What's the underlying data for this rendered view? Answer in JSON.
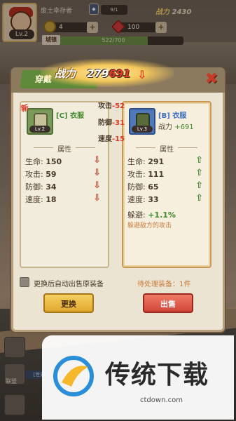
{
  "hud": {
    "player_name": "废土幸存者",
    "level": "Lv.2",
    "vip": "9/1",
    "power_label": "战力",
    "power_value": "2430",
    "coins": "4",
    "gems": "100",
    "xp_text": "522/700",
    "xp_progress": 0.746,
    "levelup_label": "城镇"
  },
  "dialog": {
    "tab_label": "穿戴",
    "power_label": "战力",
    "power_value_prefix": "279",
    "power_value_red": "691",
    "close_icon": "close-icon",
    "floating_diffs": [
      {
        "label": "攻击",
        "value": "-52"
      },
      {
        "label": "防御",
        "value": "-31"
      },
      {
        "label": "速度",
        "value": "-15"
      }
    ],
    "current": {
      "new_tag": "新",
      "name": "[C] 衣服",
      "level": "Lv.2",
      "section": "属性",
      "stats": [
        {
          "label": "生命:",
          "value": "150",
          "trend": "down"
        },
        {
          "label": "攻击:",
          "value": "59",
          "trend": "down"
        },
        {
          "label": "防御:",
          "value": "34",
          "trend": "down"
        },
        {
          "label": "速度:",
          "value": "18",
          "trend": "down"
        }
      ]
    },
    "candidate": {
      "name": "[B] 衣服",
      "level": "Lv.3",
      "power_label": "战力",
      "power_diff": "+691",
      "section": "属性",
      "stats": [
        {
          "label": "生命:",
          "value": "291",
          "trend": "up"
        },
        {
          "label": "攻击:",
          "value": "111",
          "trend": "up"
        },
        {
          "label": "防御:",
          "value": "65",
          "trend": "up"
        },
        {
          "label": "速度:",
          "value": "33",
          "trend": "up"
        }
      ],
      "dodge_label": "躲避:",
      "dodge_value": "+1.1%",
      "dodge_desc": "躲避敌方的攻击"
    },
    "auto_sell_label": "更换后自动出售原装备",
    "pending_label": "待处理装备：1件",
    "swap_button": "更换",
    "sell_button": "出售"
  },
  "bottom_nav": {
    "alliance": "联盟",
    "chat_tag": "[世界"
  },
  "watermark": {
    "title": "传统下载",
    "url": "ctdown.com"
  },
  "colors": {
    "accent_red": "#e23a26",
    "accent_green": "#3e8a2a",
    "button_yellow": "#f5d060",
    "button_red": "#d2463a"
  }
}
